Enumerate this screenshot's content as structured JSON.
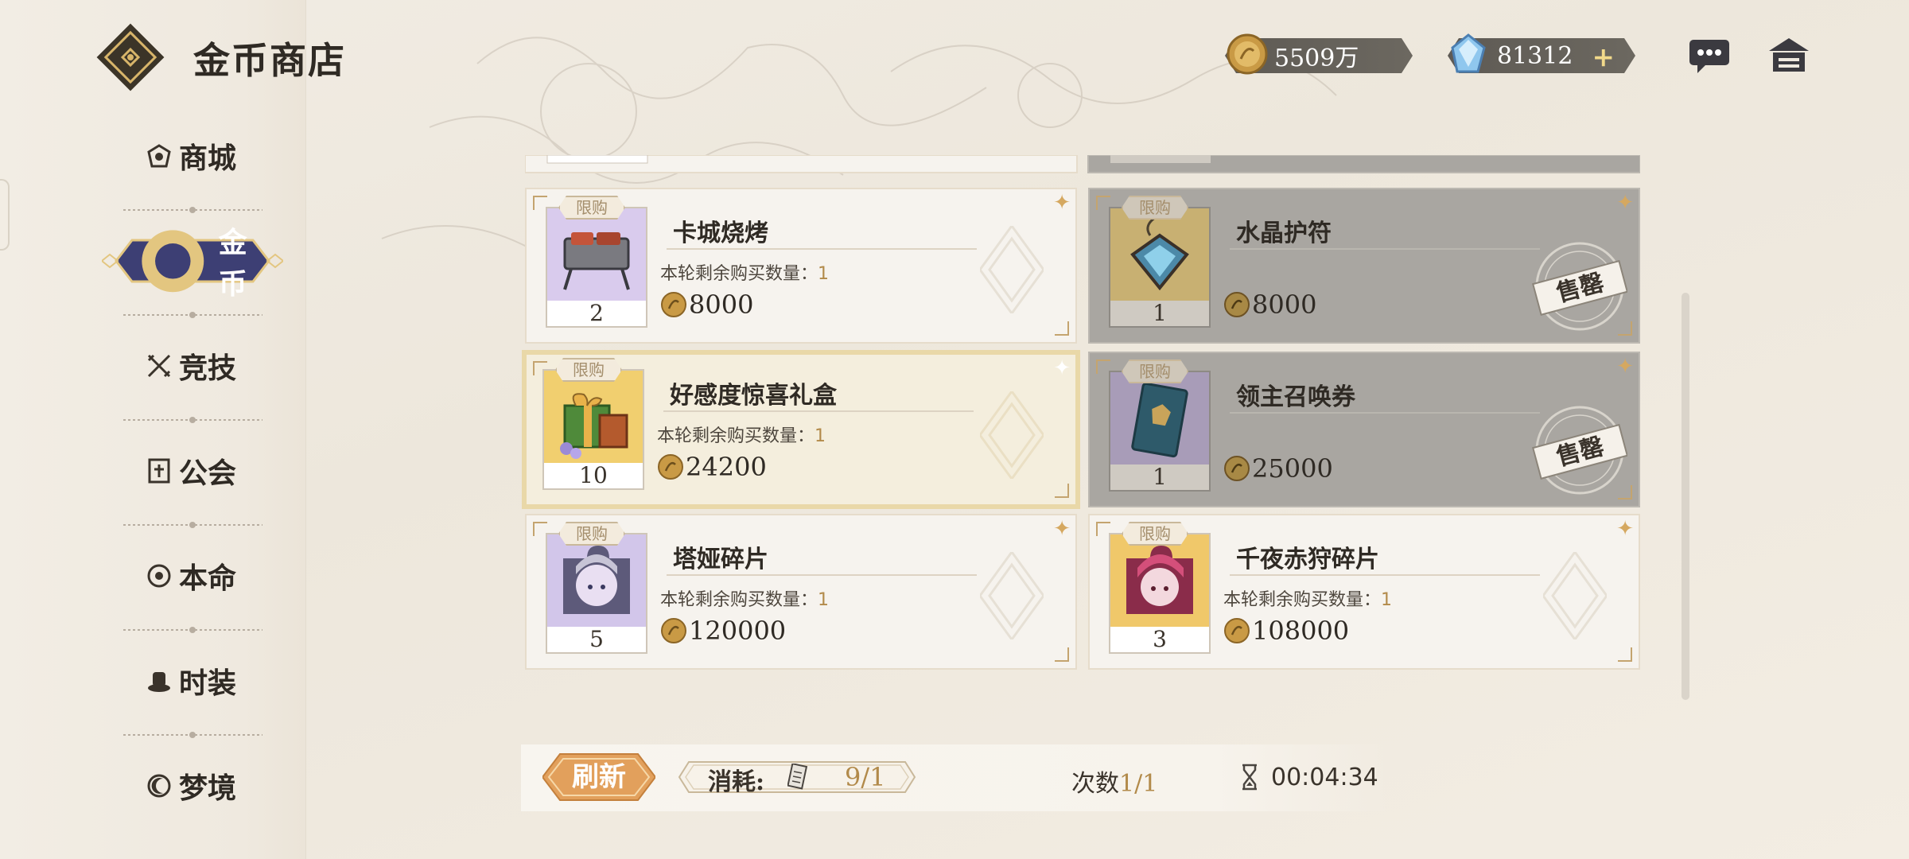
{
  "header": {
    "title": "金币商店",
    "gold_amount": "5509万",
    "crystal_amount": "81312",
    "crystal_plus": "+",
    "icons": [
      "shop-logo-icon",
      "gold-coin-icon",
      "crystal-icon",
      "chat-icon",
      "home-icon"
    ]
  },
  "sidebar": {
    "items": [
      {
        "label": "商城",
        "icon": "mall-icon"
      },
      {
        "label": "金币",
        "icon": "coin-icon",
        "active": true
      },
      {
        "label": "竞技",
        "icon": "swords-icon"
      },
      {
        "label": "公会",
        "icon": "guild-icon"
      },
      {
        "label": "本命",
        "icon": "emblem-icon"
      },
      {
        "label": "时装",
        "icon": "hat-icon"
      },
      {
        "label": "梦境",
        "icon": "moon-icon"
      }
    ]
  },
  "shop": {
    "tag_label": "限购",
    "remaining_label": "本轮剩余购买数量：",
    "sold_out_label": "售罄",
    "items": [
      {
        "name": "卡城烧烤",
        "qty": "2",
        "remaining": "1",
        "price": "8000",
        "sold_out": false
      },
      {
        "name": "水晶护符",
        "qty": "1",
        "remaining": "",
        "price": "8000",
        "sold_out": true
      },
      {
        "name": "好感度惊喜礼盒",
        "qty": "10",
        "remaining": "1",
        "price": "24200",
        "sold_out": false,
        "selected": true
      },
      {
        "name": "领主召唤券",
        "qty": "1",
        "remaining": "",
        "price": "25000",
        "sold_out": true
      },
      {
        "name": "塔娅碎片",
        "qty": "5",
        "remaining": "1",
        "price": "120000",
        "sold_out": false
      },
      {
        "name": "千夜赤狩碎片",
        "qty": "3",
        "remaining": "1",
        "price": "108000",
        "sold_out": false
      }
    ]
  },
  "footer": {
    "refresh_label": "刷新",
    "cost_label": "消耗:",
    "cost_value": "9/1",
    "times_label": "次数",
    "times_value": "1/1",
    "timer": "00:04:34"
  },
  "colors": {
    "accent_gold": "#b28a4a",
    "nav_active": "#3d3f74",
    "refresh_orange": "#e2a05c",
    "soldout_gray": "#a9a6a1"
  }
}
